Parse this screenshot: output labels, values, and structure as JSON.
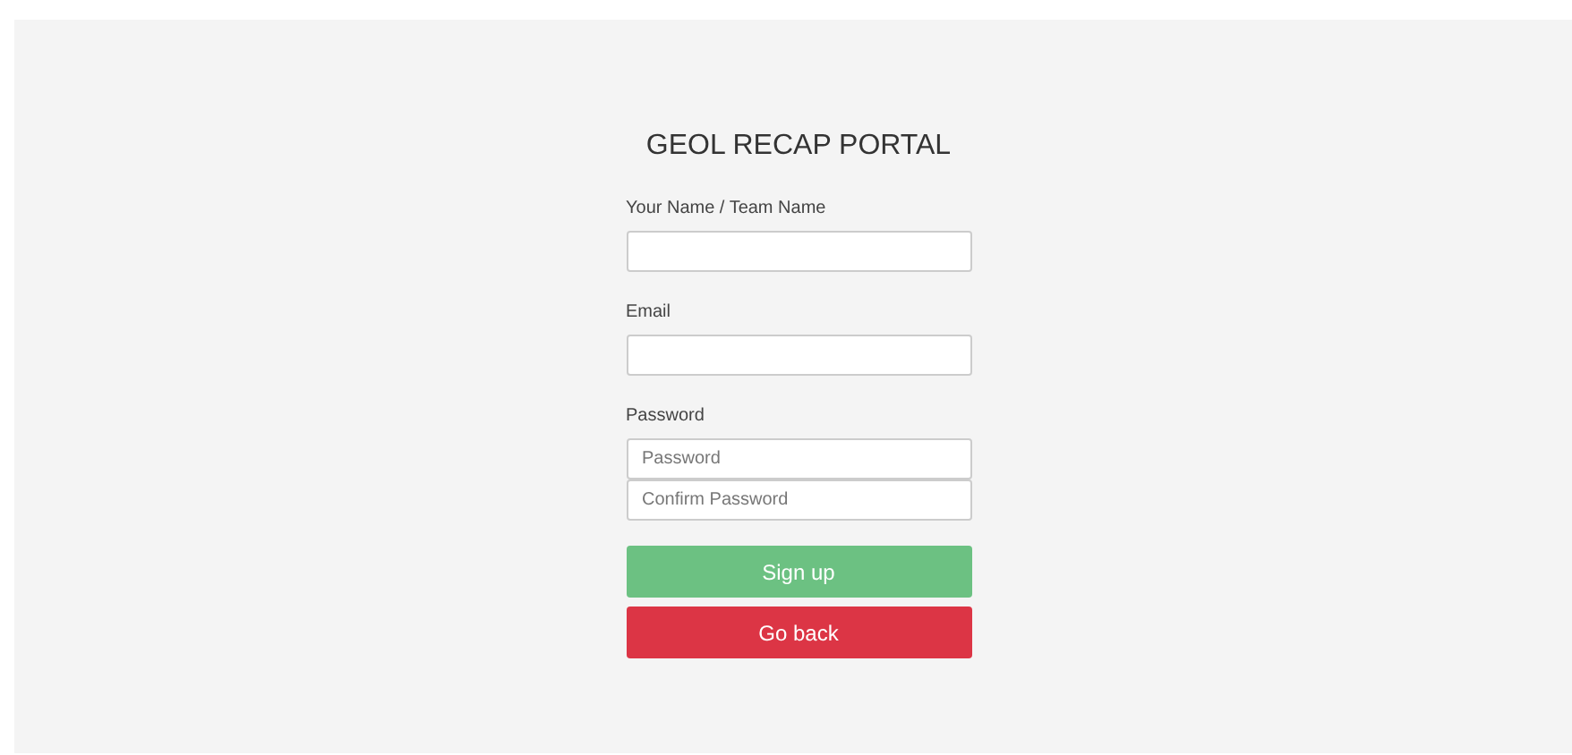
{
  "title": "GEOL RECAP PORTAL",
  "fields": [
    {
      "kind": "labeled",
      "label": "Your Name / Team Name"
    },
    {
      "kind": "labeled",
      "label": "Email"
    },
    {
      "kind": "group",
      "label": "Password",
      "inputs": [
        {
          "placeholder": "Password"
        },
        {
          "placeholder": "Confirm Password"
        }
      ]
    }
  ],
  "buttons": [
    {
      "label": "Sign up",
      "kind": "success"
    },
    {
      "label": "Go back",
      "kind": "danger"
    }
  ]
}
